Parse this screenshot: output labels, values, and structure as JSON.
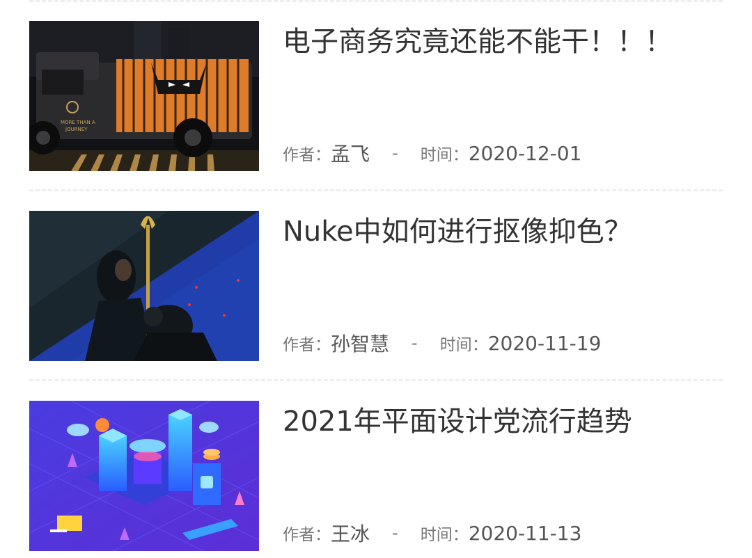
{
  "articles": [
    {
      "title": "电子商务究竟还能不能干！！！",
      "author_label": "作者：",
      "author": "孟飞",
      "separator": "-",
      "date_label": "时间：",
      "date": "2020-12-01",
      "thumbnail": "cage-truck-image",
      "thumbnail_text": [
        "MORE THAN A",
        "JOURNEY"
      ]
    },
    {
      "title": "Nuke中如何进行抠像抑色？",
      "author_label": "作者：",
      "author": "孙智慧",
      "separator": "-",
      "date_label": "时间：",
      "date": "2020-11-19",
      "thumbnail": "aquaman-keying-image"
    },
    {
      "title": "2021年平面设计党流行趋势",
      "author_label": "作者：",
      "author": "王冰",
      "separator": "-",
      "date_label": "时间：",
      "date": "2020-11-13",
      "thumbnail": "isometric-city-illustration"
    }
  ],
  "colors": {
    "title": "#333333",
    "meta_label": "#777777",
    "meta_value": "#555555",
    "divider": "#eeeeee"
  }
}
